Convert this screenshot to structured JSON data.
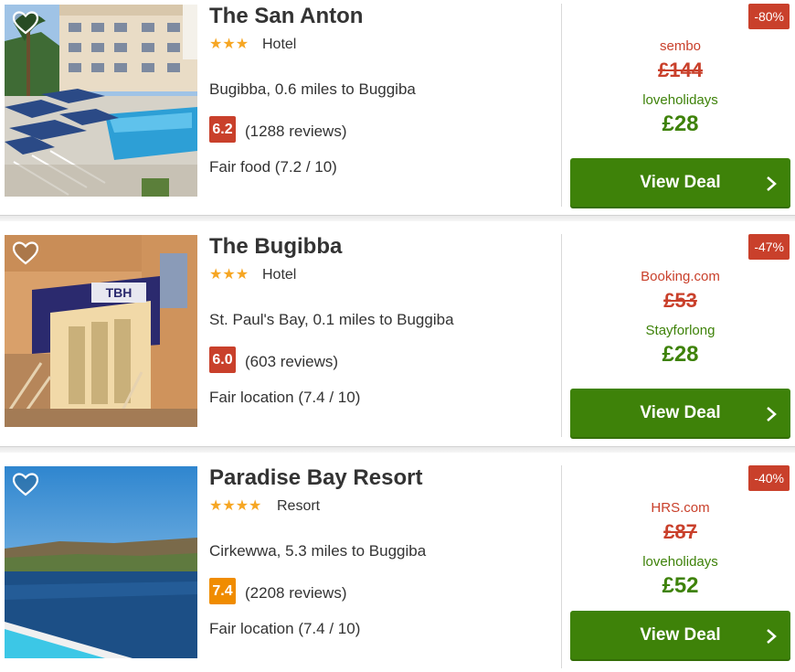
{
  "hotels": [
    {
      "name": "The San Anton",
      "stars": "★★★",
      "type": "Hotel",
      "location": "Bugibba, 0.6 miles to Buggiba",
      "rating": "6.2",
      "rating_color": "#c9402b",
      "reviews": "(1288 reviews)",
      "subscore": "Fair food (7.2 / 10)",
      "discount": "-80%",
      "strike_provider": "sembo",
      "old_price": "£144",
      "deal_provider": "loveholidays",
      "price": "£28",
      "cta": "View Deal"
    },
    {
      "name": "The Bugibba",
      "stars": "★★★",
      "type": "Hotel",
      "location": "St. Paul's Bay, 0.1 miles to Buggiba",
      "rating": "6.0",
      "rating_color": "#c9402b",
      "reviews": "(603 reviews)",
      "subscore": "Fair location (7.4 / 10)",
      "discount": "-47%",
      "strike_provider": "Booking.com",
      "old_price": "£53",
      "deal_provider": "Stayforlong",
      "price": "£28",
      "cta": "View Deal",
      "photo_sign": "TBH"
    },
    {
      "name": "Paradise Bay Resort",
      "stars": "★★★★",
      "type": "Resort",
      "location": "Cirkewwa, 5.3 miles to Buggiba",
      "rating": "7.4",
      "rating_color": "#f08c00",
      "reviews": "(2208 reviews)",
      "subscore": "Fair location (7.4 / 10)",
      "discount": "-40%",
      "strike_provider": "HRS.com",
      "old_price": "£87",
      "deal_provider": "loveholidays",
      "price": "£52",
      "cta": "View Deal"
    }
  ],
  "colors": {
    "deal_green": "#3e8209",
    "discount_red": "#c9402b",
    "star_orange": "#f6a623"
  }
}
